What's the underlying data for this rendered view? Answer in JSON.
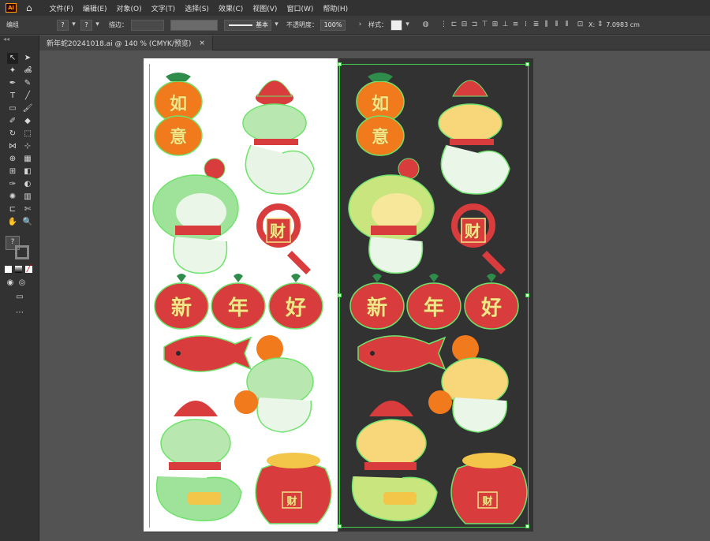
{
  "app": {
    "logo": "Ai"
  },
  "menus": [
    "文件(F)",
    "编辑(E)",
    "对象(O)",
    "文字(T)",
    "选择(S)",
    "效果(C)",
    "视图(V)",
    "窗口(W)",
    "帮助(H)"
  ],
  "control_bar": {
    "group_label": "编组",
    "stroke_label": "描边：",
    "profile_label": "基本",
    "opacity_label": "不透明度：",
    "opacity_value": "100%",
    "style_label": "样式：",
    "x_label": "X:",
    "x_value": "7.0983 cm",
    "question": "?"
  },
  "document_tab": {
    "title": "新年蛇20241018.ai @ 140 % (CMYK/预览)",
    "close": "×"
  },
  "artwork_text": {
    "ruyi_1": "如",
    "ruyi_2": "意",
    "greeting": [
      "新",
      "年",
      "好"
    ],
    "fortune": "财"
  },
  "colors": {
    "red": "#d83c3c",
    "orange": "#f07a1c",
    "gold": "#f3e58a",
    "outline_selected": "#43d04a",
    "dark_artboard": "#323232"
  },
  "icons": {
    "home": "home-icon",
    "selection": "selection-tool-icon"
  }
}
